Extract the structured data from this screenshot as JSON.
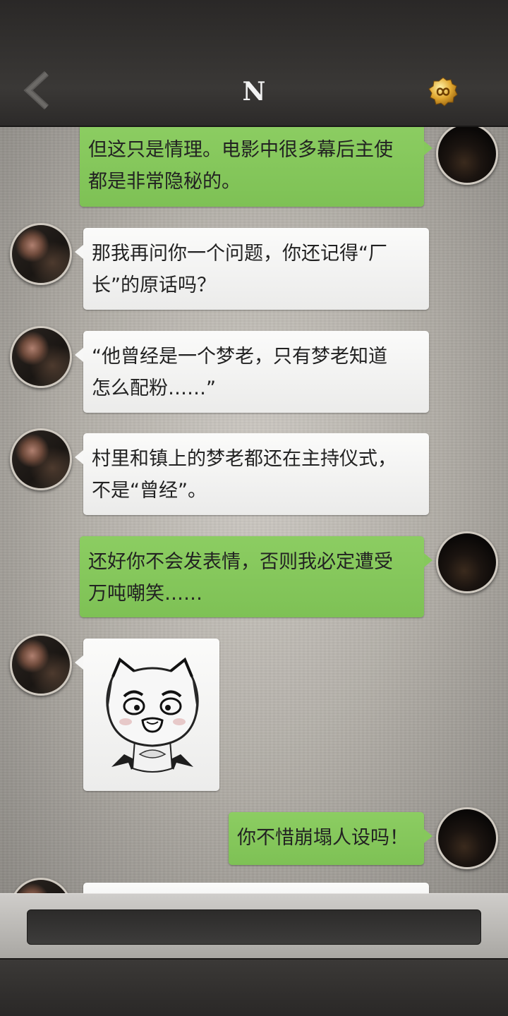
{
  "header": {
    "title": "N",
    "back_icon": "chevron-left-icon",
    "menu_icon": "gold-infinity-badge-icon"
  },
  "messages": [
    {
      "side": "self",
      "text_lines": [
        "但这只是情理。电影中很多幕后主使",
        "都是非常隐秘的。"
      ]
    },
    {
      "side": "other",
      "text_lines": [
        "那我再问你一个问题，你还记得“厂",
        "长”的原话吗？"
      ]
    },
    {
      "side": "other",
      "text_lines": [
        "“他曾经是一个梦老，只有梦老知道",
        "怎么配粉……”"
      ]
    },
    {
      "side": "other",
      "text_lines": [
        "村里和镇上的梦老都还在主持仪式，",
        "不是“曾经”。"
      ]
    },
    {
      "side": "self",
      "text_lines": [
        "还好你不会发表情，否则我必定遭受",
        "万吨嘲笑……"
      ]
    },
    {
      "side": "other",
      "sticker": "cartoon-cat-sticker"
    },
    {
      "side": "self",
      "text_lines": [
        "你不惜崩塌人设吗！"
      ]
    }
  ],
  "input": {
    "value": ""
  },
  "colors": {
    "self_bubble": "#86c85c",
    "other_bubble": "#f7f7f6",
    "topbar": "#33312f"
  }
}
